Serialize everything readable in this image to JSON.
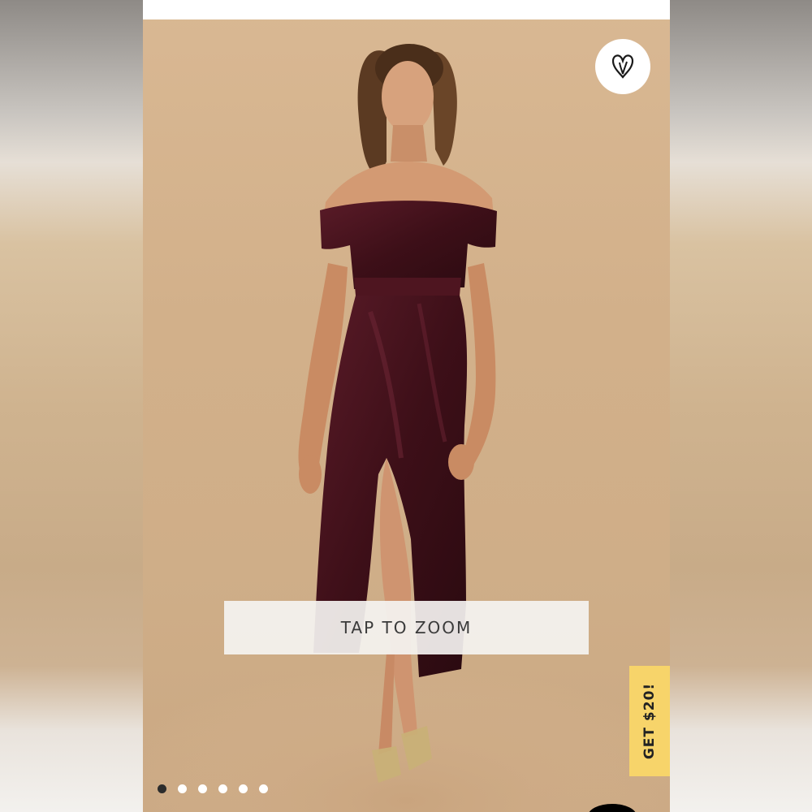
{
  "product": {
    "image_alt": "Model wearing off-the-shoulder burgundy velvet midi dress with wrap slit",
    "colors": {
      "background": "#d6b48e",
      "dress": "#4a1620",
      "promo": "#f7d46a"
    }
  },
  "actions": {
    "favorite_icon": "heart-icon",
    "zoom_label": "TAP TO ZOOM",
    "promo_label": "GET $20!"
  },
  "carousel": {
    "total": 6,
    "active_index": 0
  }
}
